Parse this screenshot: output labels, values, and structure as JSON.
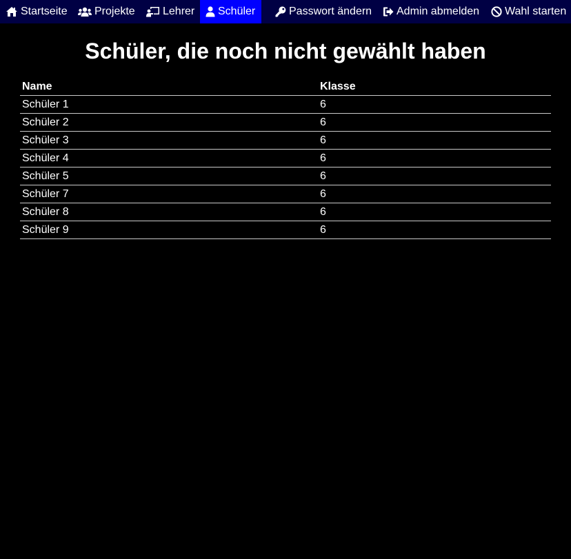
{
  "nav": {
    "items": [
      {
        "label": "Startseite",
        "icon": "home-icon"
      },
      {
        "label": "Projekte",
        "icon": "users-icon"
      },
      {
        "label": "Lehrer",
        "icon": "chalkboard-teacher-icon"
      },
      {
        "label": "Schüler",
        "icon": "user-icon"
      },
      {
        "label": "Passwort ändern",
        "icon": "key-icon"
      },
      {
        "label": "Admin abmelden",
        "icon": "sign-out-icon"
      },
      {
        "label": "Wahl starten",
        "icon": "ban-icon"
      }
    ],
    "active": "Schüler"
  },
  "page": {
    "title": "Schüler, die noch nicht gewählt haben"
  },
  "table": {
    "headers": [
      "Name",
      "Klasse"
    ],
    "rows": [
      [
        "Schüler 1",
        "6"
      ],
      [
        "Schüler 2",
        "6"
      ],
      [
        "Schüler 3",
        "6"
      ],
      [
        "Schüler 4",
        "6"
      ],
      [
        "Schüler 5",
        "6"
      ],
      [
        "Schüler 7",
        "6"
      ],
      [
        "Schüler 8",
        "6"
      ],
      [
        "Schüler 9",
        "6"
      ]
    ]
  },
  "colors": {
    "navbar_bg": "#000044",
    "active_bg": "#0000ff",
    "page_bg": "#000000",
    "text": "#ffffff"
  }
}
